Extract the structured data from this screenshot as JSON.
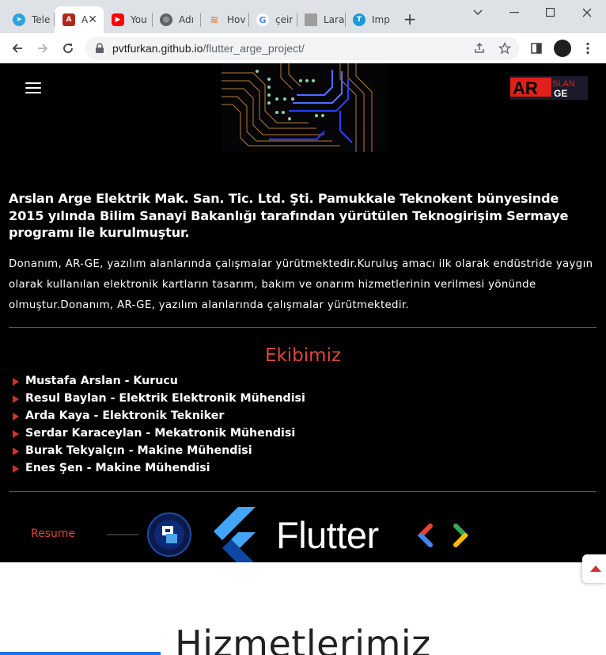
{
  "browser": {
    "tabs": [
      {
        "label": "Tele",
        "favicon": "telegram-icon",
        "color": "#2aa3de"
      },
      {
        "label": "A",
        "favicon": "arslan-arge-icon",
        "color": "#b3261e",
        "active": true
      },
      {
        "label": "You",
        "favicon": "youtube-icon",
        "color": "#ff0000"
      },
      {
        "label": "Adı",
        "favicon": "globe-icon",
        "color": "#5f6368"
      },
      {
        "label": "Hov",
        "favicon": "stackoverflow-icon",
        "color": "#f48024"
      },
      {
        "label": "çeir",
        "favicon": "google-icon",
        "color": "#4285f4"
      },
      {
        "label": "Lara",
        "favicon": "laravel-thumbnail-icon",
        "color": "#9e9e9e"
      },
      {
        "label": "Imp",
        "favicon": "tp-icon",
        "color": "#1a9bd7"
      }
    ],
    "url_host": "pvtfurkan.github.io",
    "url_path": "/flutter_arge_project/"
  },
  "header": {
    "logo_top": "SLAN",
    "logo_bottom": "GE",
    "logo_prefix": "AR"
  },
  "intro": {
    "title": "Arslan Arge Elektrik Mak. San. Tic. Ltd. Şti. Pamukkale Teknokent bünyesinde 2015 yılında Bilim Sanayi Bakanlığı tarafından yürütülen Teknogirişim Sermaye programı ile kurulmuştur.",
    "text": "Donanım, AR-GE, yazılım alanlarında çalışmalar yürütmektedir.Kuruluş amacı ilk olarak endüstride yaygın olarak kullanılan elektronik kartların tasarım, bakım ve onarım hizmetlerinin verilmesi yönünde olmuştur.Donanım, AR-GE, yazılım alanlarında çalışmalar yürütmektedir."
  },
  "team": {
    "title": "Ekibimiz",
    "members": [
      "Mustafa Arslan - Kurucu",
      "Resul Baylan - Elektrik Elektronik Mühendisi",
      "Arda Kaya - Elektronik Tekniker",
      "Serdar Karaceylan - Mekatronik Mühendisi",
      "Burak Tekyalçın - Makine Mühendisi",
      "Enes Şen - Makine Mühendisi"
    ]
  },
  "footer_strip": {
    "resume_label": "Resume",
    "flutter_label": "Flutter"
  },
  "services": {
    "title": "Hizmetlerimiz"
  },
  "colors": {
    "accent": "#e0453a",
    "bullet": "#d32f2f",
    "page_bg": "#000000"
  }
}
